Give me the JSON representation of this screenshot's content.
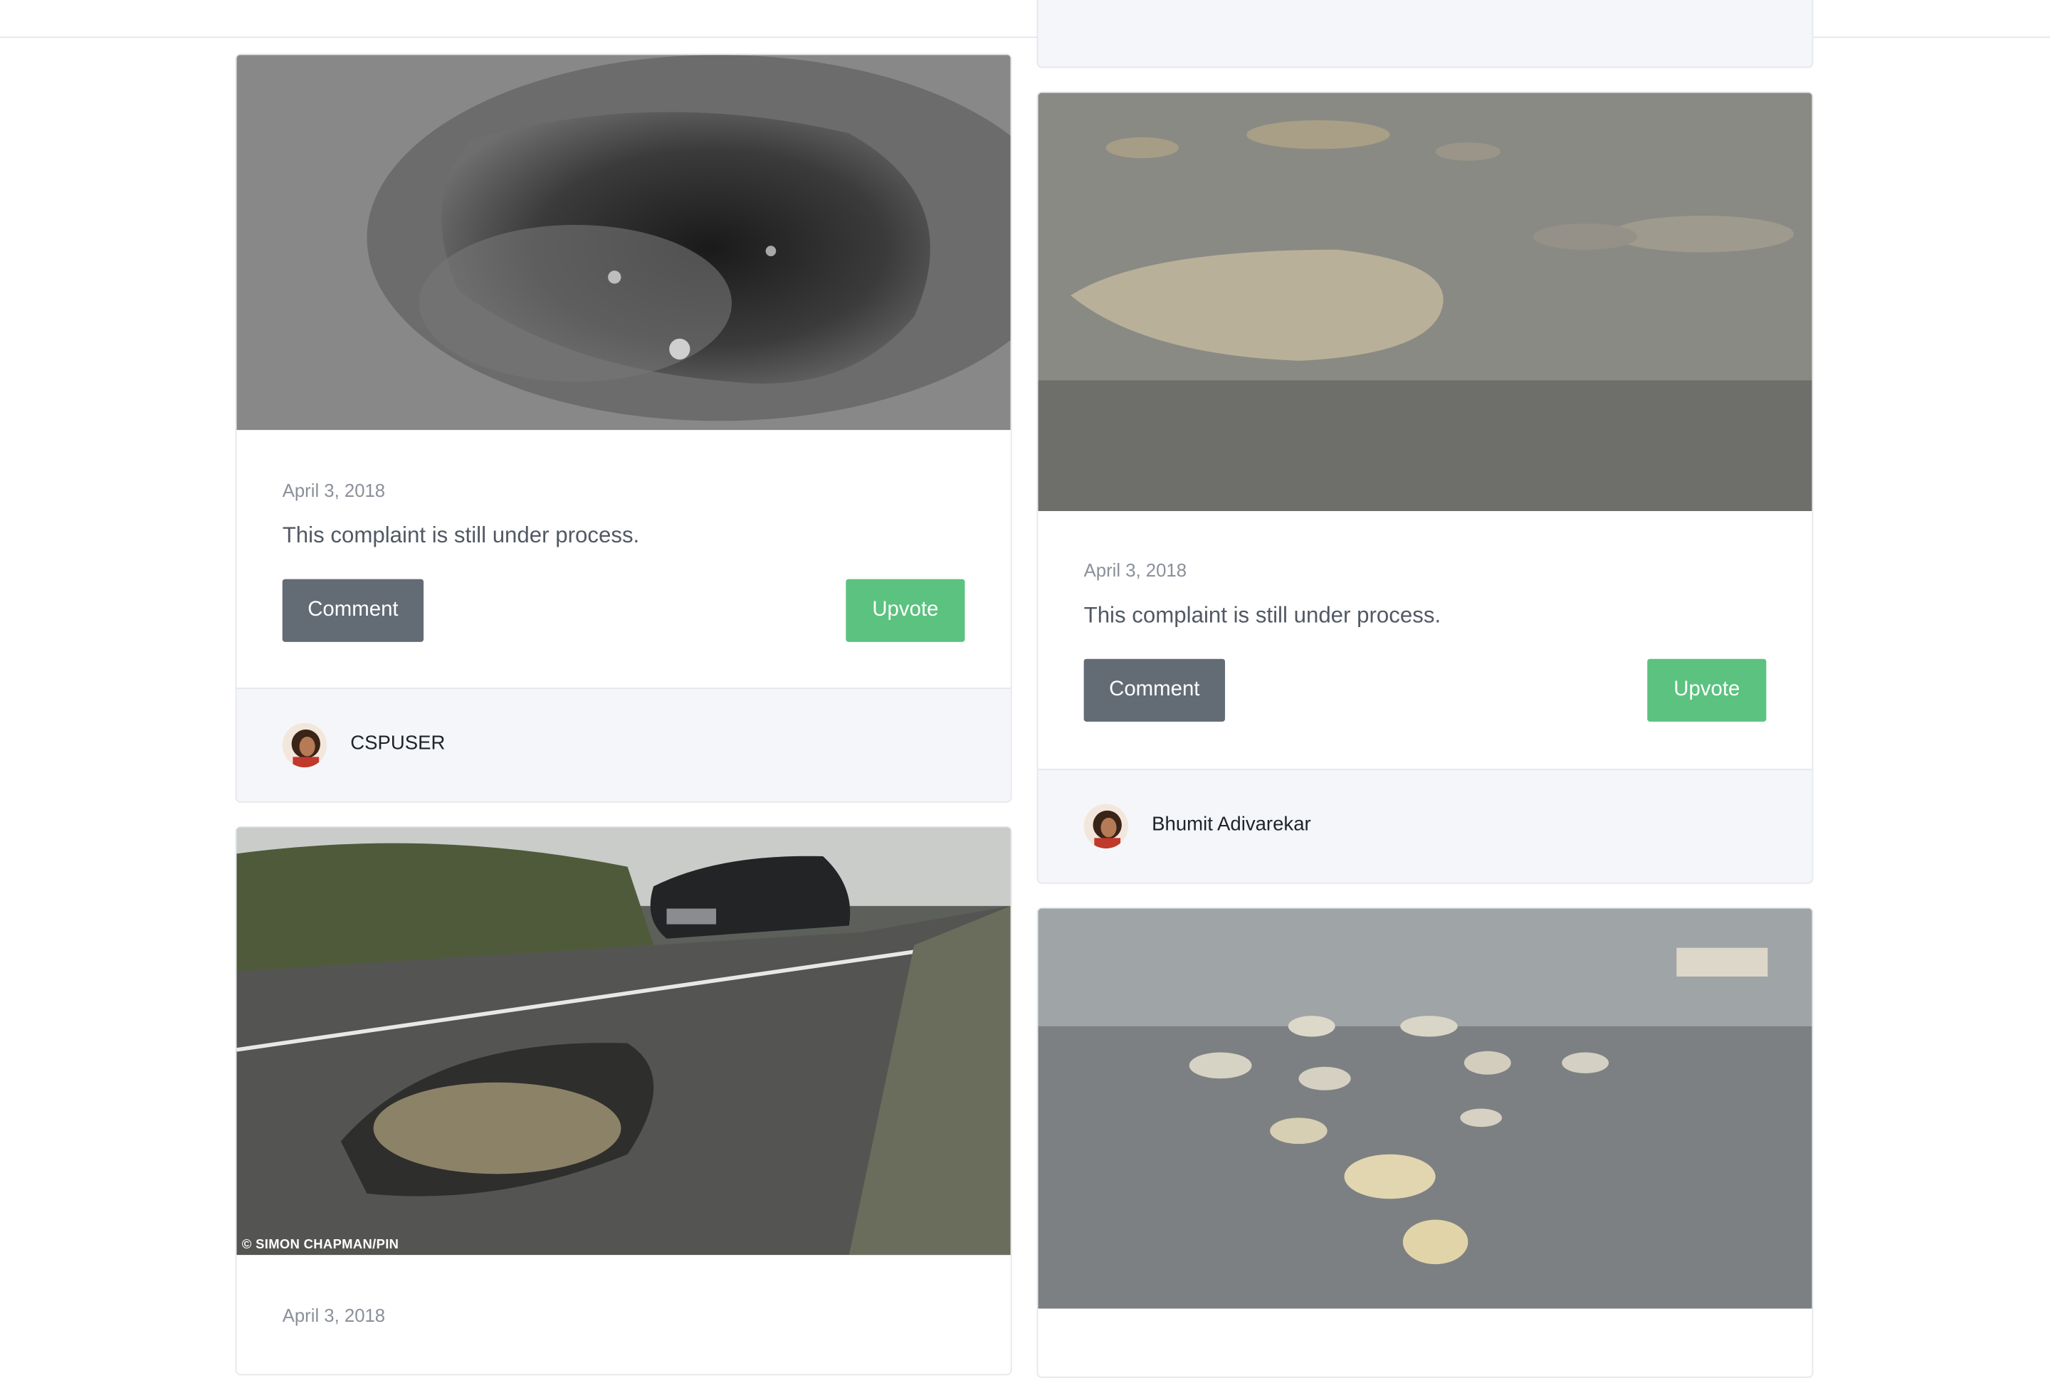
{
  "posts": [
    {
      "date": "April 3, 2018",
      "message": "This complaint is still under process.",
      "comment_label": "Comment",
      "upvote_label": "Upvote",
      "user": "CSPUSER"
    },
    {
      "date": "April 3, 2018",
      "message": "This complaint is still under process.",
      "comment_label": "Comment",
      "upvote_label": "Upvote",
      "user": "Bhumit Adivarekar"
    },
    {
      "date": "April 3, 2018",
      "photo_credit": "© SIMON CHAPMAN/PIN"
    }
  ],
  "colors": {
    "comment_button": "#636b75",
    "upvote_button": "#5bc27f",
    "footer_bg": "#f4f6f9"
  }
}
